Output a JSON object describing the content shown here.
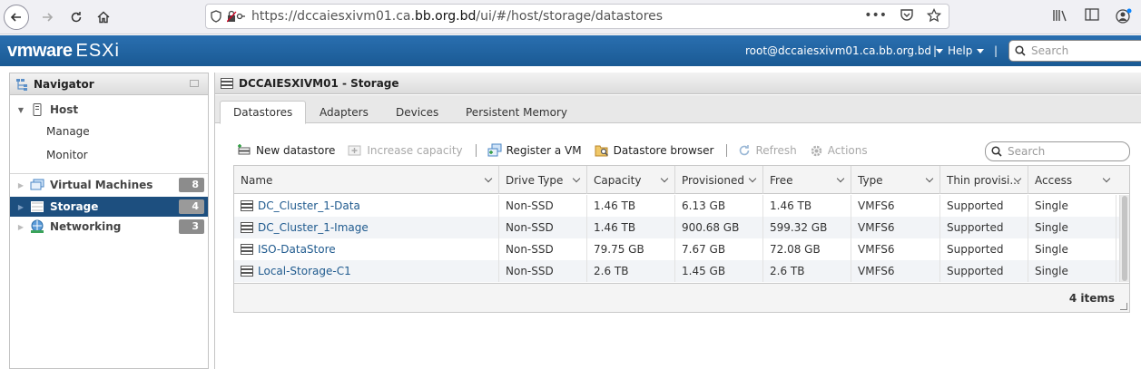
{
  "browser": {
    "url_prefix": "https://dccaiesxivm01.ca.",
    "url_host": "bb.org.bd",
    "url_path": "/ui/#/host/storage/datastores",
    "more_icon": "•••"
  },
  "header": {
    "logo_vm": "vmware",
    "logo_product": "ESXi",
    "user": "root@dccaiesxivm01.ca.bb.org.bd",
    "help": "Help",
    "search_placeholder": "Search"
  },
  "navigator": {
    "title": "Navigator",
    "items": [
      {
        "label": "Host",
        "icon": "host-icon"
      },
      {
        "label": "Manage"
      },
      {
        "label": "Monitor"
      },
      {
        "label": "Virtual Machines",
        "count": "8",
        "icon": "vm-icon"
      },
      {
        "label": "Storage",
        "count": "4",
        "icon": "storage-icon"
      },
      {
        "label": "Networking",
        "count": "3",
        "icon": "network-icon"
      }
    ]
  },
  "main": {
    "title": "DCCAIESXIVM01 - Storage",
    "tabs": [
      {
        "label": "Datastores"
      },
      {
        "label": "Adapters"
      },
      {
        "label": "Devices"
      },
      {
        "label": "Persistent Memory"
      }
    ],
    "toolbar": {
      "new_datastore": "New datastore",
      "increase_capacity": "Increase capacity",
      "register_vm": "Register a VM",
      "datastore_browser": "Datastore browser",
      "refresh": "Refresh",
      "actions": "Actions"
    },
    "search_placeholder": "Search",
    "columns": [
      "Name",
      "Drive Type",
      "Capacity",
      "Provisioned",
      "Free",
      "Type",
      "Thin provisi...",
      "Access"
    ],
    "rows": [
      [
        "DC_Cluster_1-Data",
        "Non-SSD",
        "1.46 TB",
        "6.13 GB",
        "1.46 TB",
        "VMFS6",
        "Supported",
        "Single"
      ],
      [
        "DC_Cluster_1-Image",
        "Non-SSD",
        "1.46 TB",
        "900.68 GB",
        "599.32 GB",
        "VMFS6",
        "Supported",
        "Single"
      ],
      [
        "ISO-DataStore",
        "Non-SSD",
        "79.75 GB",
        "7.67 GB",
        "72.08 GB",
        "VMFS6",
        "Supported",
        "Single"
      ],
      [
        "Local-Storage-C1",
        "Non-SSD",
        "2.6 TB",
        "1.45 GB",
        "2.6 TB",
        "VMFS6",
        "Supported",
        "Single"
      ]
    ],
    "items_count": "4 items"
  },
  "colors": {
    "header_blue": "#1d5f9a",
    "selected_nav": "#1d4f7f",
    "link": "#1f5a8e"
  }
}
